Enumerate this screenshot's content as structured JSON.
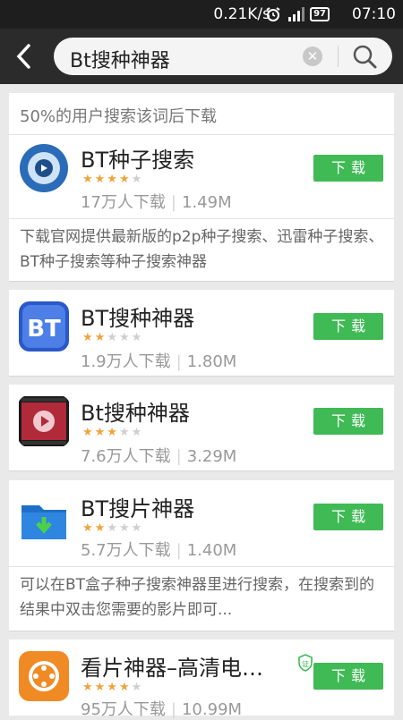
{
  "status_bar": {
    "speed": "0.21K/s",
    "battery": "97",
    "time": "07:10"
  },
  "search": {
    "query": "Bt搜种神器"
  },
  "hint": "50%的用户搜索该词后下载",
  "download_label": "下载",
  "apps": [
    {
      "name": "BT种子搜索",
      "rating": 4,
      "downloads": "17万人下载",
      "size": "1.49M",
      "description": "下载官网提供最新版的p2p种子搜索、迅雷种子搜索、BT种子搜索等种子搜索神器"
    },
    {
      "name": "BT搜种神器",
      "rating": 2,
      "downloads": "1.9万人下载",
      "size": "1.80M"
    },
    {
      "name": "Bt搜种神器",
      "rating": 3,
      "downloads": "7.6万人下载",
      "size": "3.29M"
    },
    {
      "name": "BT搜片神器",
      "rating": 2,
      "downloads": "5.7万人下载",
      "size": "1.40M",
      "description": "可以在BT盒子种子搜索神器里进行搜索，在搜索到的结果中双击您需要的影片即可..."
    },
    {
      "name": "看片神器–高清电…",
      "rating": 4,
      "downloads": "95万人下载",
      "size": "10.99M"
    }
  ],
  "icons": {
    "back": "chevron-left-icon",
    "clear": "clear-icon",
    "search": "search-icon",
    "verified": "shield-icon"
  },
  "colors": {
    "download_button": "#3fba55",
    "star": "#f2a33b",
    "header": "#2b2b2b"
  }
}
